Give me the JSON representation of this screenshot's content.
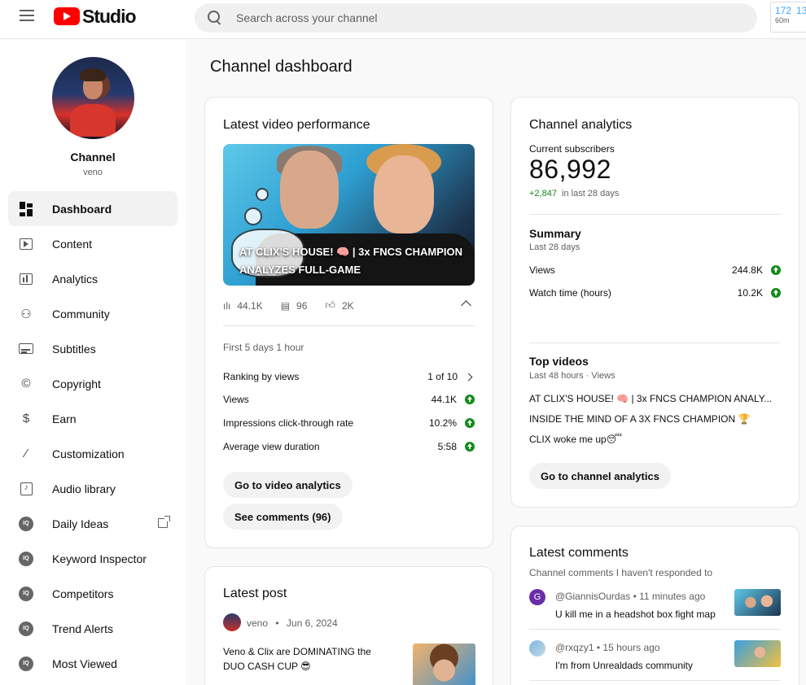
{
  "header": {
    "app_name": "Studio",
    "search_placeholder": "Search across your channel",
    "realtime_values": [
      "172",
      "13"
    ],
    "realtime_sub": "60m"
  },
  "sidebar": {
    "channel_name": "Channel",
    "channel_handle": "veno",
    "items": [
      {
        "label": "Dashboard",
        "icon": "dashboard-icon",
        "active": true
      },
      {
        "label": "Content",
        "icon": "content-icon"
      },
      {
        "label": "Analytics",
        "icon": "analytics-icon"
      },
      {
        "label": "Community",
        "icon": "community-icon"
      },
      {
        "label": "Subtitles",
        "icon": "subtitles-icon"
      },
      {
        "label": "Copyright",
        "icon": "copyright-icon"
      },
      {
        "label": "Earn",
        "icon": "earn-icon"
      },
      {
        "label": "Customization",
        "icon": "customization-icon"
      },
      {
        "label": "Audio library",
        "icon": "audio-library-icon"
      },
      {
        "label": "Daily Ideas",
        "icon": "extension-icon",
        "external": true
      },
      {
        "label": "Keyword Inspector",
        "icon": "extension-icon"
      },
      {
        "label": "Competitors",
        "icon": "extension-icon"
      },
      {
        "label": "Trend Alerts",
        "icon": "extension-icon"
      },
      {
        "label": "Most Viewed",
        "icon": "extension-icon"
      }
    ]
  },
  "main": {
    "title": "Channel dashboard"
  },
  "latest_video": {
    "title": "Latest video performance",
    "thumbnail_text": "AT CLIX'S HOUSE! 🧠 | 3x FNCS CHAMPION ANALYZES FULL-GAME",
    "views": "44.1K",
    "comments": "96",
    "likes": "2K",
    "period": "First 5 days 1 hour",
    "metrics": [
      {
        "label": "Ranking by views",
        "value": "1 of 10",
        "type": "chevron"
      },
      {
        "label": "Views",
        "value": "44.1K",
        "type": "up"
      },
      {
        "label": "Impressions click-through rate",
        "value": "10.2%",
        "type": "up"
      },
      {
        "label": "Average view duration",
        "value": "5:58",
        "type": "up"
      }
    ],
    "btn_analytics": "Go to video analytics",
    "btn_comments": "See comments (96)"
  },
  "latest_post": {
    "title": "Latest post",
    "author": "veno",
    "date": "Jun 6, 2024",
    "text": "Veno & Clix are DOMINATING the DUO CASH CUP 😎"
  },
  "channel_analytics": {
    "title": "Channel analytics",
    "subs_label": "Current subscribers",
    "subs_value": "86,992",
    "subs_change": "+2,847",
    "subs_change_period": "in last 28 days",
    "summary_title": "Summary",
    "summary_period": "Last 28 days",
    "summary": [
      {
        "label": "Views",
        "value": "244.8K"
      },
      {
        "label": "Watch time (hours)",
        "value": "10.2K"
      }
    ],
    "top_title": "Top videos",
    "top_period": "Last 48 hours · Views",
    "top_videos": [
      "AT CLIX'S HOUSE! 🧠 | 3x FNCS CHAMPION ANALY...",
      "INSIDE THE MIND OF A 3X FNCS CHAMPION 🏆",
      "CLIX woke me up😴"
    ],
    "btn": "Go to channel analytics"
  },
  "latest_comments": {
    "title": "Latest comments",
    "subtitle": "Channel comments I haven't responded to",
    "items": [
      {
        "avatar_letter": "G",
        "user": "@GiannisOurdas",
        "time": "11 minutes ago",
        "text": "U kill me in a headshot box fight map"
      },
      {
        "avatar_letter": "",
        "user": "@rxqzy1",
        "time": "15 hours ago",
        "text": "I'm from Unrealdads community"
      }
    ]
  },
  "colors": {
    "accent_red": "#ff0000",
    "positive_green": "#138a1a",
    "realtime_blue": "#3ea6ff"
  }
}
